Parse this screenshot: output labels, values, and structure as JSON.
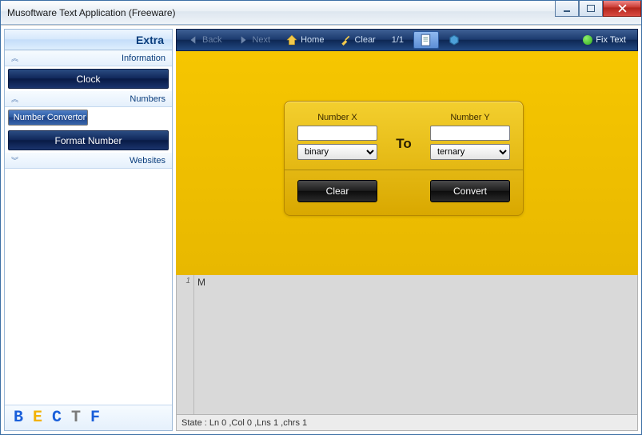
{
  "window": {
    "title": "Musoftware Text Application (Freeware)"
  },
  "sidebar": {
    "title": "Extra",
    "sections": {
      "information": "Information",
      "numbers": "Numbers",
      "websites": "Websites"
    },
    "buttons": {
      "clock": "Clock",
      "number_convertor": "Number Convertor",
      "format_number": "Format Number"
    },
    "footer_letters": {
      "b": "B",
      "e": "E",
      "c": "C",
      "t": "T",
      "f": "F"
    }
  },
  "toolbar": {
    "back": "Back",
    "next": "Next",
    "home": "Home",
    "clear": "Clear",
    "page": "1/1",
    "fix": "Fix Text"
  },
  "convertor": {
    "label_x": "Number X",
    "label_y": "Number Y",
    "to": "To",
    "from_select": "binary",
    "to_select": "ternary",
    "clear_btn": "Clear",
    "convert_btn": "Convert"
  },
  "editor": {
    "gutter_first": "1",
    "content": "M"
  },
  "status": "State :  Ln 0 ,Col 0 ,Lns 1 ,chrs 1"
}
